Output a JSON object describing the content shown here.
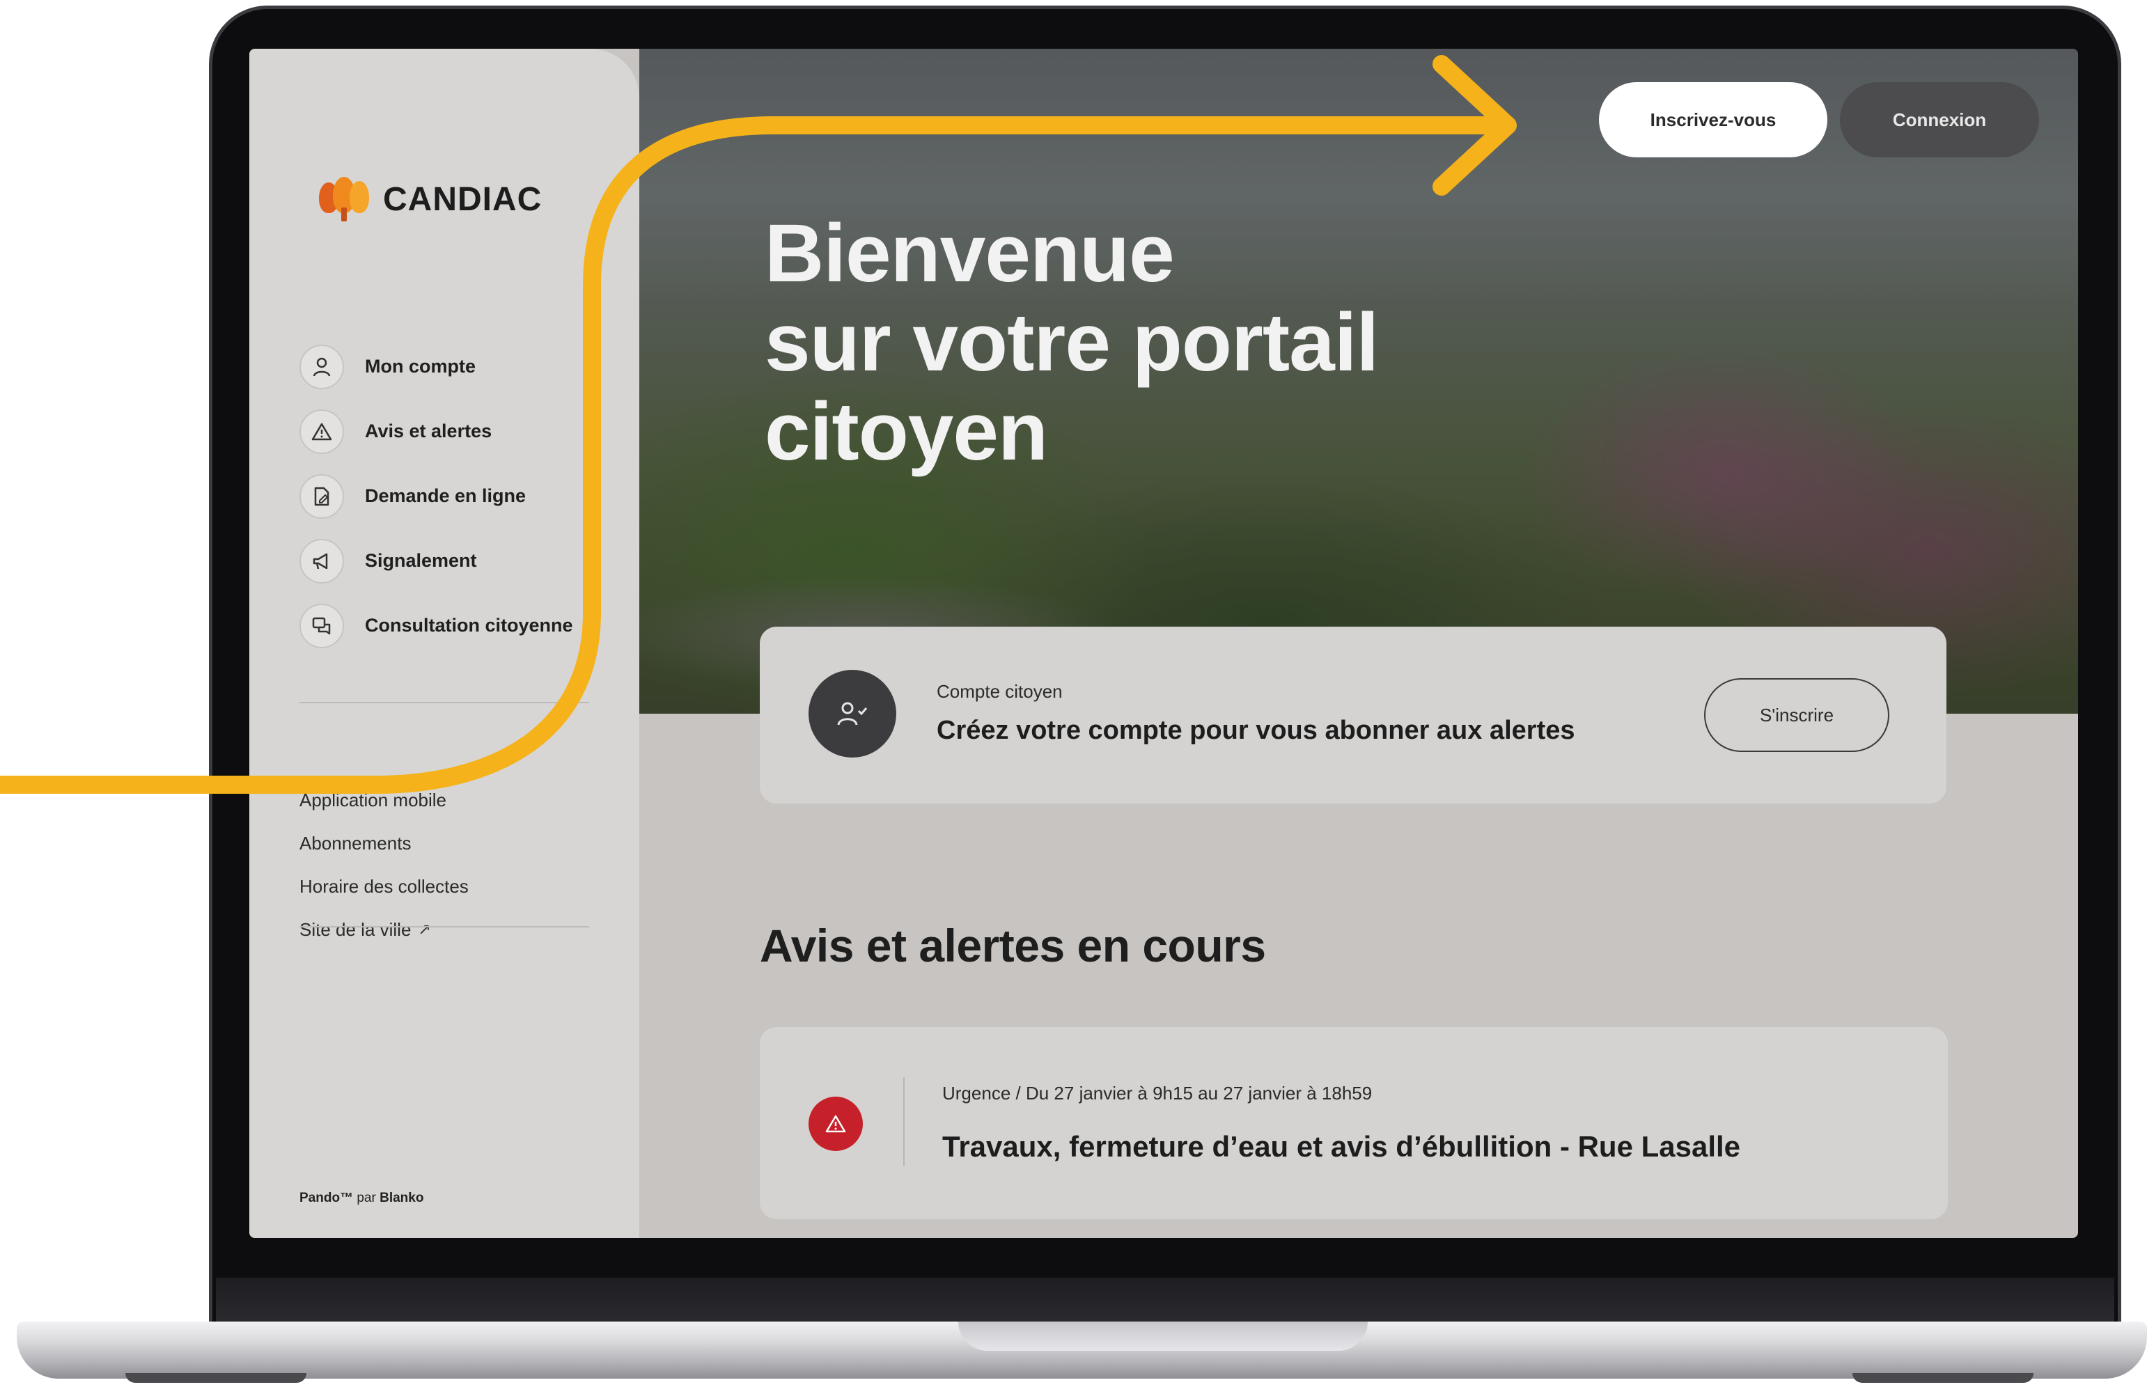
{
  "brand": {
    "name": "CANDIAC"
  },
  "header": {
    "signup_label": "Inscrivez-vous",
    "login_label": "Connexion"
  },
  "hero": {
    "title_lines": [
      "Bienvenue",
      "sur votre portail",
      "citoyen"
    ]
  },
  "sidebar": {
    "items": [
      {
        "label": "Mon compte",
        "icon": "user-icon"
      },
      {
        "label": "Avis et alertes",
        "icon": "warning-icon"
      },
      {
        "label": "Demande en ligne",
        "icon": "document-edit-icon"
      },
      {
        "label": "Signalement",
        "icon": "megaphone-icon"
      },
      {
        "label": "Consultation citoyenne",
        "icon": "chat-bubbles-icon"
      }
    ],
    "links": [
      {
        "label": "Application mobile"
      },
      {
        "label": "Abonnements"
      },
      {
        "label": "Horaire des collectes"
      },
      {
        "label": "Site de la ville"
      }
    ],
    "footer": {
      "product": "Pando™",
      "by": "par",
      "company": "Blanko"
    }
  },
  "account_card": {
    "kicker": "Compte citoyen",
    "text": "Créez votre compte pour vous abonner aux alertes",
    "button_label": "S'inscrire"
  },
  "alerts": {
    "section_title": "Avis et alertes en cours",
    "items": [
      {
        "category": "Urgence",
        "dates": "/ Du 27 janvier à 9h15 au 27 janvier à 18h59",
        "title": "Travaux, fermeture d’eau et avis d’ébullition  - Rue Lasalle",
        "status_color": "#c6202a"
      }
    ]
  },
  "colors": {
    "annotation": "#f5b21a",
    "sidebar_bg": "#d7d6d4",
    "page_bg": "#c7c4c1",
    "alert_red": "#c6202a"
  }
}
